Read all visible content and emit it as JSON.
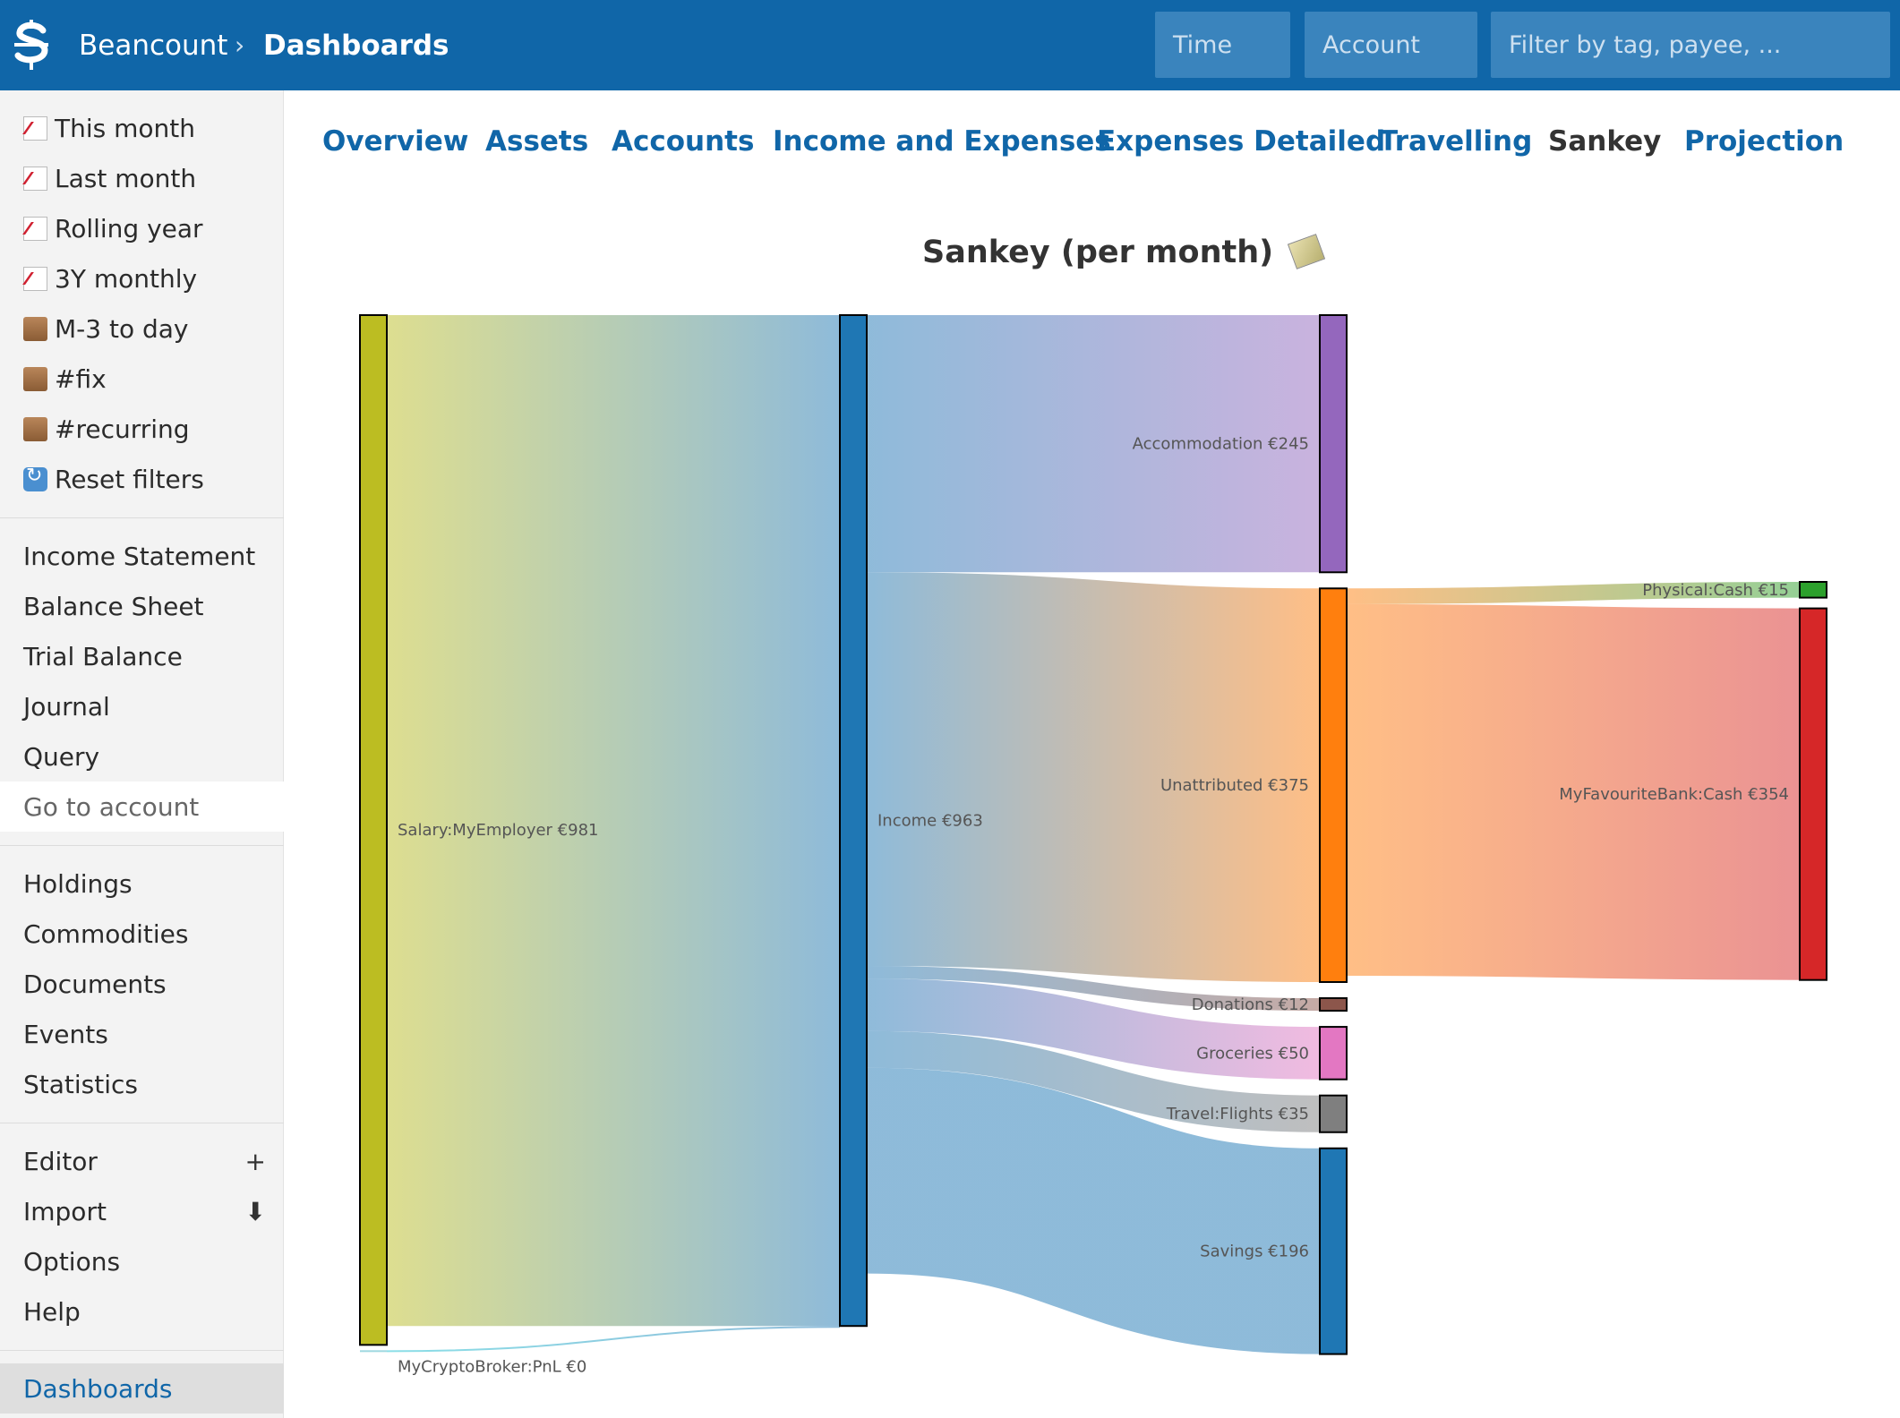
{
  "header": {
    "app_name": "Beancount",
    "separator": "›",
    "page": "Dashboards",
    "time_placeholder": "Time",
    "account_placeholder": "Account",
    "filter_placeholder": "Filter by tag, payee, ..."
  },
  "sidebar": {
    "filters": [
      {
        "label": "This month",
        "icon": "chart-increasing-icon"
      },
      {
        "label": "Last month",
        "icon": "chart-increasing-icon"
      },
      {
        "label": "Rolling year",
        "icon": "chart-increasing-icon"
      },
      {
        "label": "3Y monthly",
        "icon": "chart-increasing-icon"
      },
      {
        "label": "M-3 to day",
        "icon": "scroll-icon"
      },
      {
        "label": "#fix",
        "icon": "scroll-icon"
      },
      {
        "label": "#recurring",
        "icon": "scroll-icon"
      },
      {
        "label": "Reset filters",
        "icon": "reset-icon"
      }
    ],
    "reports": [
      "Income Statement",
      "Balance Sheet",
      "Trial Balance",
      "Journal",
      "Query",
      "Go to account"
    ],
    "views": [
      "Holdings",
      "Commodities",
      "Documents",
      "Events",
      "Statistics"
    ],
    "tools": [
      {
        "label": "Editor",
        "extra": "+"
      },
      {
        "label": "Import",
        "extra": "⬇"
      },
      {
        "label": "Options",
        "extra": ""
      },
      {
        "label": "Help",
        "extra": ""
      }
    ],
    "extensions": [
      "Dashboards"
    ]
  },
  "tabs": [
    "Overview",
    "Assets",
    "Accounts",
    "Income and Expenses",
    "Expenses Detailed",
    "Travelling",
    "Sankey",
    "Projection"
  ],
  "active_tab": "Sankey",
  "chart_data": {
    "type": "sankey",
    "title": "Sankey (per month)",
    "currency": "€",
    "nodes": [
      {
        "id": "salary",
        "label": "Salary:MyEmployer €981",
        "color": "#bcbd22"
      },
      {
        "id": "crypto",
        "label": "MyCryptoBroker:PnL €0",
        "color": "#17becf"
      },
      {
        "id": "income",
        "label": "Income €963",
        "color": "#1f77b4"
      },
      {
        "id": "accommodation",
        "label": "Accommodation €245",
        "color": "#9467bd"
      },
      {
        "id": "unattributed",
        "label": "Unattributed €375",
        "color": "#ff7f0e"
      },
      {
        "id": "donations",
        "label": "Donations €12",
        "color": "#8c564b"
      },
      {
        "id": "groceries",
        "label": "Groceries €50",
        "color": "#e377c2"
      },
      {
        "id": "flights",
        "label": "Travel:Flights €35",
        "color": "#7f7f7f"
      },
      {
        "id": "savings",
        "label": "Savings €196",
        "color": "#1f77b4"
      },
      {
        "id": "physcash",
        "label": "Physical:Cash €15",
        "color": "#2ca02c"
      },
      {
        "id": "bank",
        "label": "MyFavouriteBank:Cash €354",
        "color": "#d62728"
      }
    ],
    "links": [
      {
        "source": "salary",
        "target": "income",
        "value": 963
      },
      {
        "source": "crypto",
        "target": "income",
        "value": 0
      },
      {
        "source": "income",
        "target": "accommodation",
        "value": 245
      },
      {
        "source": "income",
        "target": "unattributed",
        "value": 375
      },
      {
        "source": "income",
        "target": "donations",
        "value": 12
      },
      {
        "source": "income",
        "target": "groceries",
        "value": 50
      },
      {
        "source": "income",
        "target": "flights",
        "value": 35
      },
      {
        "source": "income",
        "target": "savings",
        "value": 196
      },
      {
        "source": "unattributed",
        "target": "physcash",
        "value": 15
      },
      {
        "source": "unattributed",
        "target": "bank",
        "value": 354
      }
    ]
  }
}
